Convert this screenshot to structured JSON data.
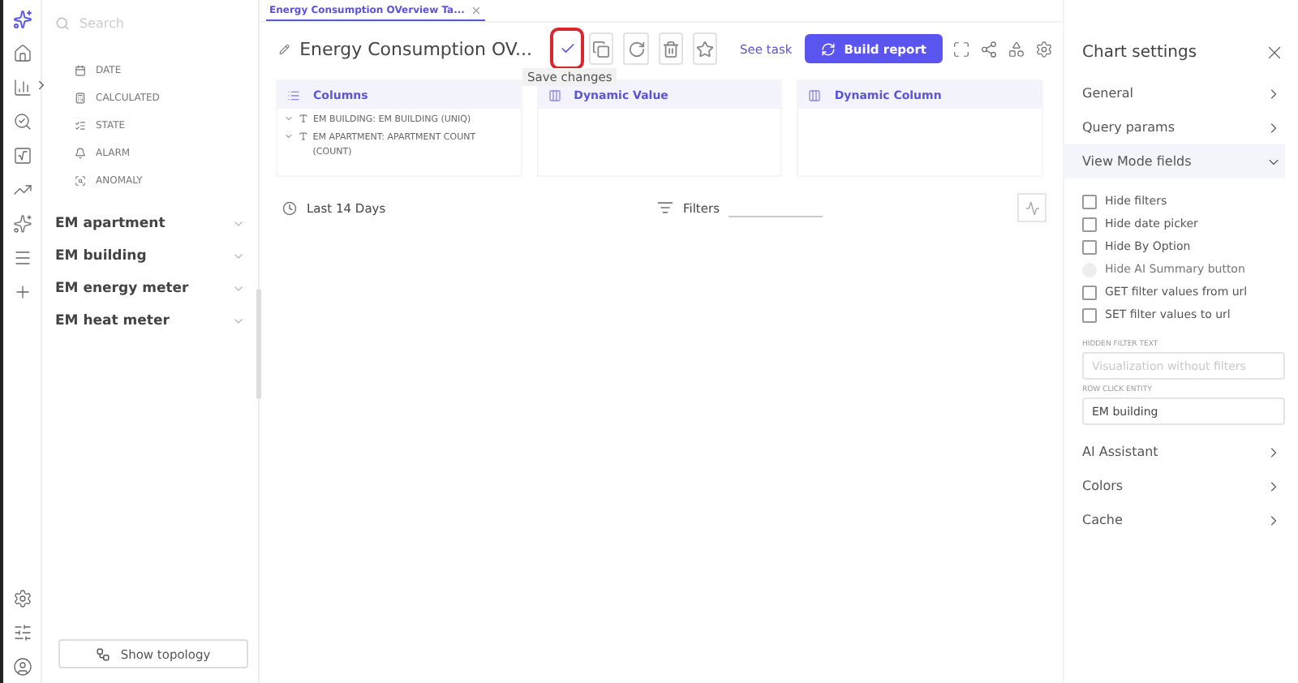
{
  "sidebar": {
    "search": {
      "placeholder": "Search"
    },
    "field_types": [
      "DATE",
      "CALCULATED",
      "STATE",
      "ALARM",
      "ANOMALY"
    ],
    "groups": [
      {
        "label": "EM apartment",
        "expanded": false
      },
      {
        "label": "EM building",
        "expanded": false
      },
      {
        "label": "EM energy meter",
        "expanded": false
      },
      {
        "label": "EM heat meter",
        "expanded": false
      }
    ],
    "button": "Show topology"
  },
  "tabs": [
    {
      "label": "Energy Consumption OVerview Ta...",
      "selected": true
    }
  ],
  "title": "Energy Consumption OV...",
  "toolbar": {
    "tooltip": "Save changes",
    "link": "See task",
    "primary_button": "Build report"
  },
  "panels": [
    {
      "kind": "list",
      "title": "Columns",
      "items": [
        "EM BUILDING: EM BUILDING (UNIQ)",
        "EM APARTMENT: APARTMENT COUNT (COUNT)"
      ]
    },
    {
      "kind": "value",
      "title": "Dynamic Value"
    },
    {
      "kind": "column",
      "title": "Dynamic Column"
    }
  ],
  "date_range": "Last 14 Days",
  "filters": {
    "label": "Filters"
  },
  "settings": {
    "title": "Chart settings",
    "sections": [
      {
        "label": "General",
        "expanded": false
      },
      {
        "label": "Query params",
        "expanded": false
      },
      {
        "label": "View Mode fields",
        "expanded": true,
        "checkboxes": [
          {
            "label": "Hide filters",
            "checked": false,
            "disabled": false
          },
          {
            "label": "Hide date picker",
            "checked": false,
            "disabled": false
          },
          {
            "label": "Hide By Option",
            "checked": false,
            "disabled": false
          },
          {
            "label": "Hide AI Summary button",
            "checked": false,
            "disabled": true
          },
          {
            "label": "GET filter values from url",
            "checked": false,
            "disabled": false
          },
          {
            "label": "SET filter values to url",
            "checked": false,
            "disabled": false
          }
        ],
        "fields": [
          {
            "label": "HIDDEN FILTER TEXT",
            "placeholder": "Visualization without filters"
          },
          {
            "label": "ROW CLICK ENTITY",
            "value": "EM building"
          }
        ]
      },
      {
        "label": "AI Assistant",
        "expanded": false
      },
      {
        "label": "Colors",
        "expanded": false
      },
      {
        "label": "Cache",
        "expanded": false
      }
    ]
  }
}
